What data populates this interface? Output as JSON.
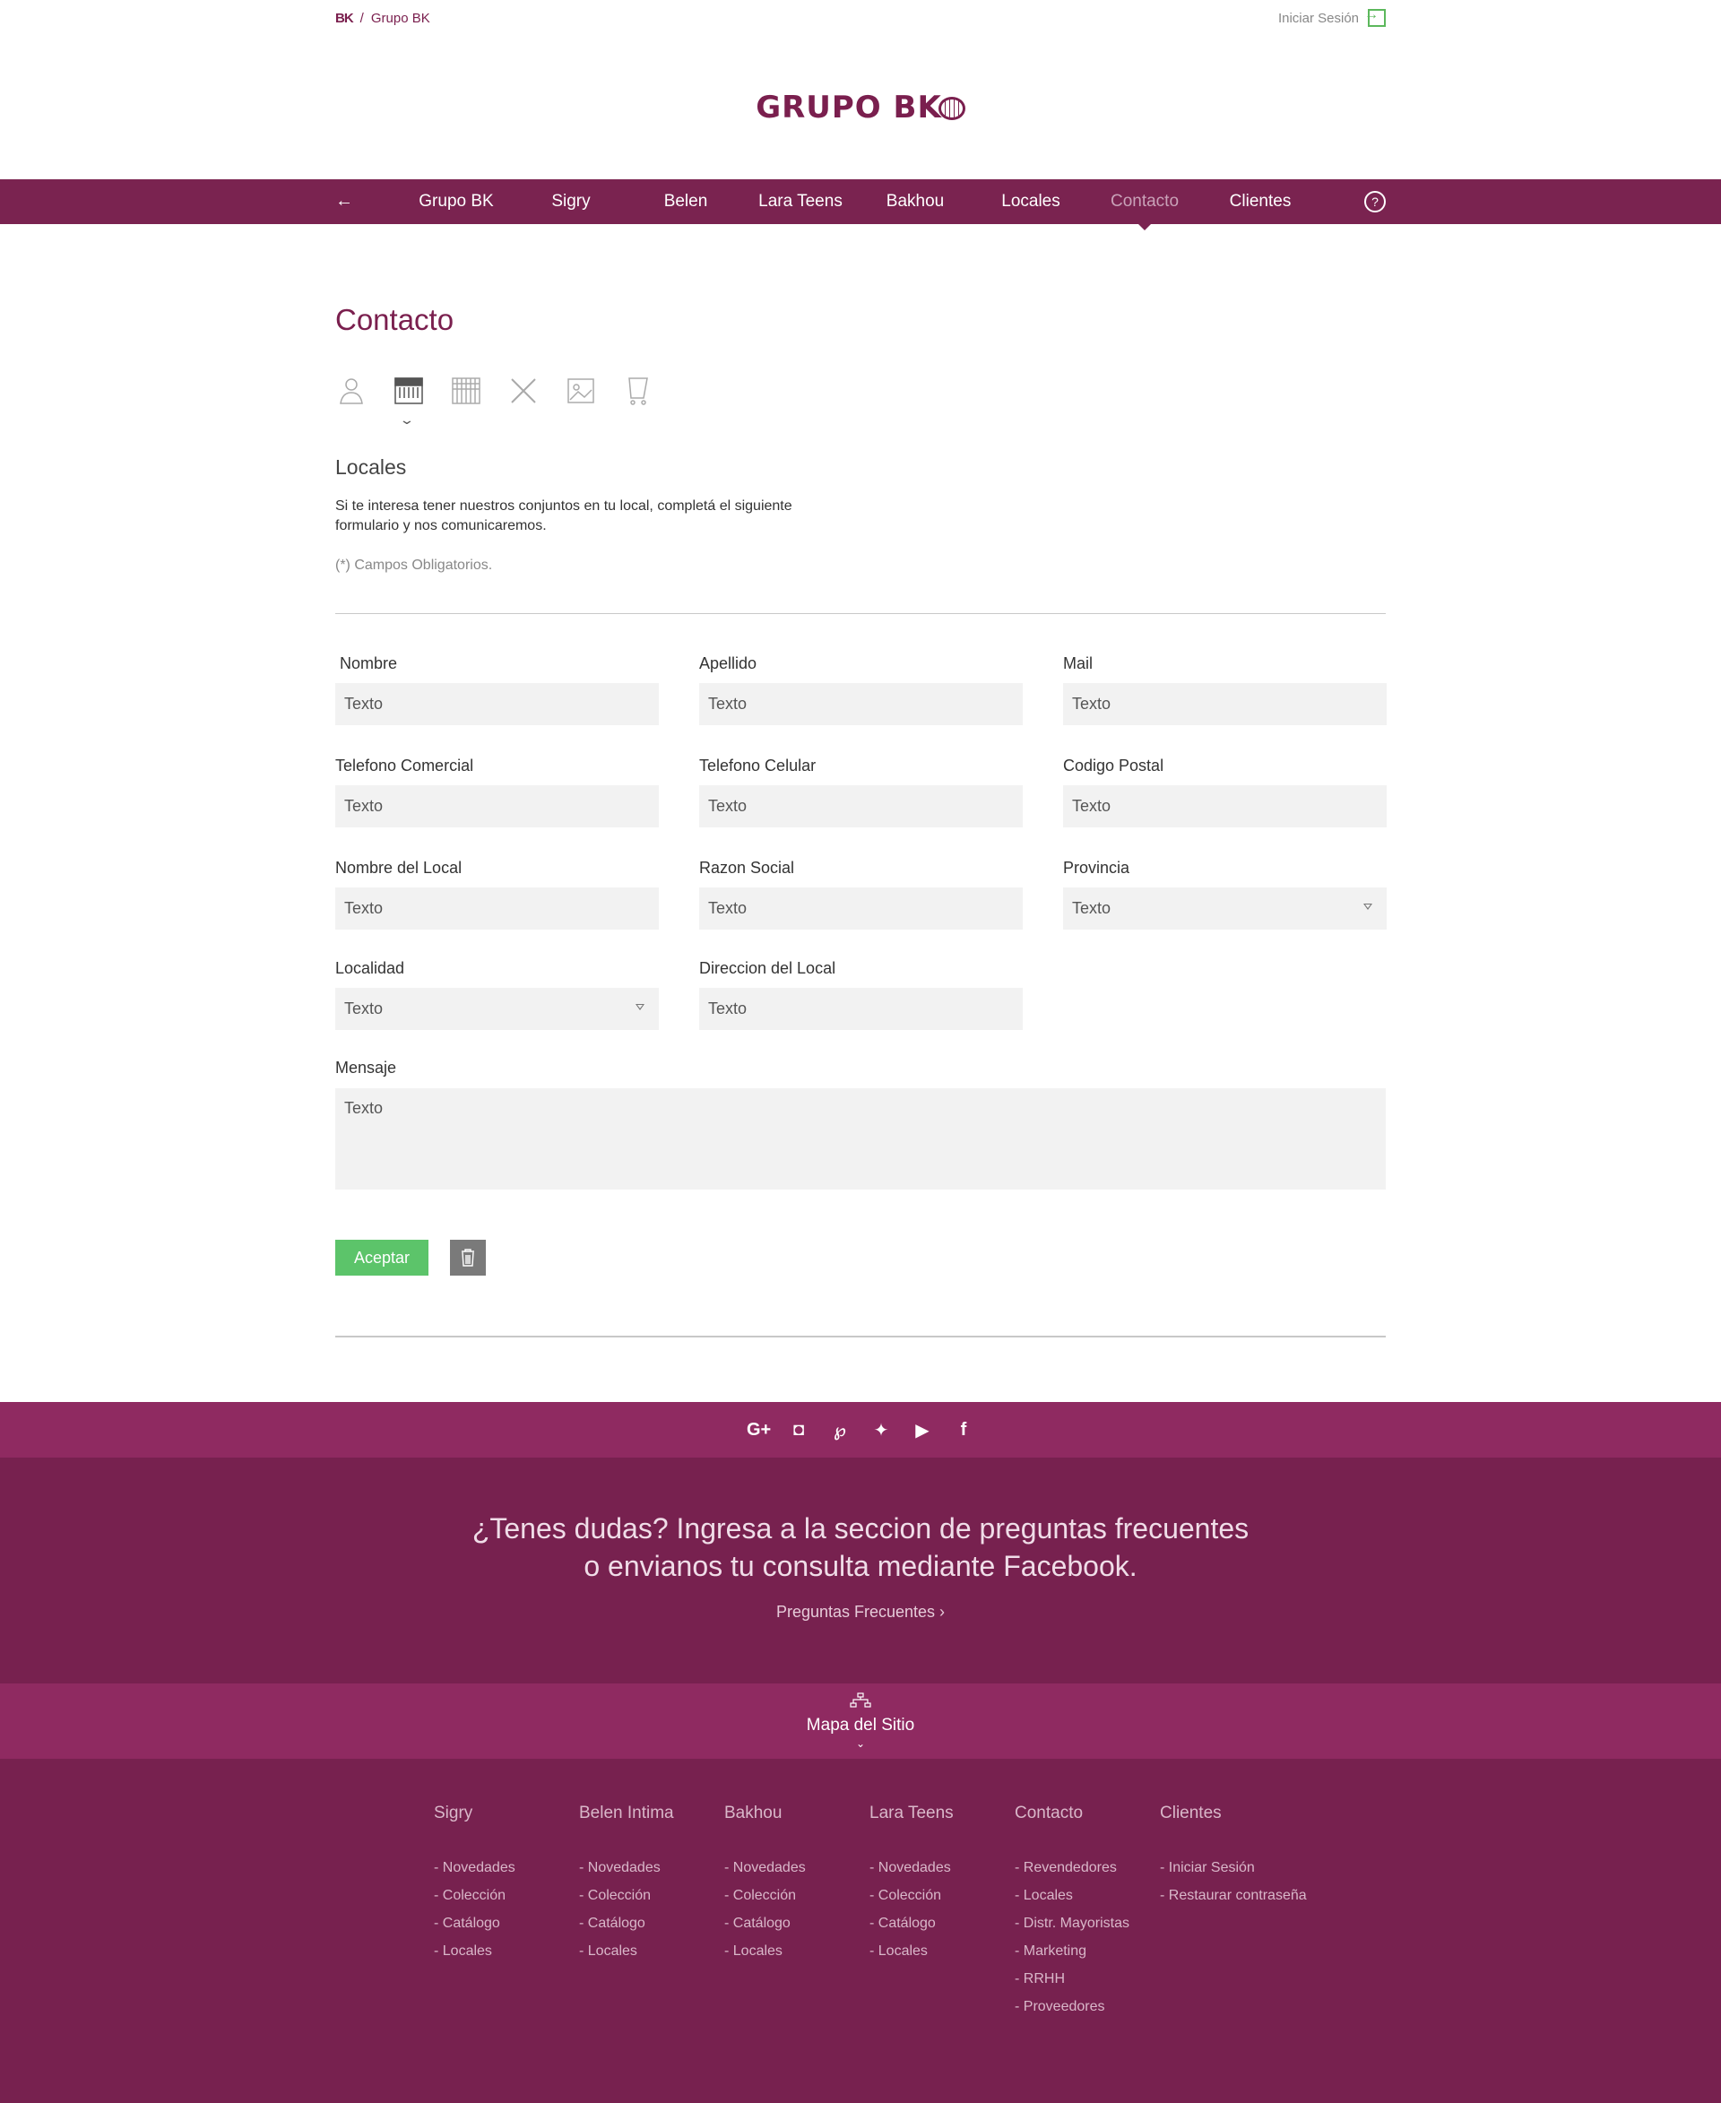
{
  "topbar": {
    "logo_mini": "BK",
    "breadcrumb_sep": "/",
    "breadcrumb_current": "Grupo BK",
    "login_label": "Iniciar Sesión"
  },
  "logo": {
    "text": "GRUPO BK"
  },
  "nav": {
    "items": [
      {
        "label": "Grupo BK"
      },
      {
        "label": "Sigry"
      },
      {
        "label": "Belen"
      },
      {
        "label": "Lara Teens"
      },
      {
        "label": "Bakhou"
      },
      {
        "label": "Locales"
      },
      {
        "label": "Contacto",
        "active": true
      },
      {
        "label": "Clientes"
      }
    ],
    "help_label": "?"
  },
  "contact": {
    "title": "Contacto",
    "categories": [
      {
        "icon": "person-icon"
      },
      {
        "icon": "storefront-icon",
        "active": true
      },
      {
        "icon": "warehouse-icon"
      },
      {
        "icon": "pencil-ruler-icon"
      },
      {
        "icon": "picture-icon"
      },
      {
        "icon": "cart-icon"
      }
    ],
    "section_title": "Locales",
    "section_desc": "Si te interesa tener nuestros conjuntos en tu local, completá el siguiente formulario y nos comunicaremos.",
    "required_note": "(*) Campos Obligatorios."
  },
  "form": {
    "fields": {
      "nombre": {
        "label": "Nombre",
        "value": "Texto"
      },
      "apellido": {
        "label": "Apellido",
        "value": "Texto"
      },
      "mail": {
        "label": "Mail",
        "value": "Texto"
      },
      "telefono_comercial": {
        "label": "Telefono Comercial",
        "value": "Texto"
      },
      "telefono_celular": {
        "label": "Telefono Celular",
        "value": "Texto"
      },
      "codigo_postal": {
        "label": "Codigo Postal",
        "value": "Texto"
      },
      "nombre_local": {
        "label": "Nombre del Local",
        "value": "Texto"
      },
      "razon_social": {
        "label": "Razon Social",
        "value": "Texto"
      },
      "provincia": {
        "label": "Provincia",
        "value": "Texto"
      },
      "localidad": {
        "label": "Localidad",
        "value": "Texto"
      },
      "direccion_local": {
        "label": "Direccion del Local",
        "value": "Texto"
      },
      "mensaje": {
        "label": "Mensaje",
        "value": "Texto"
      }
    },
    "accept_label": "Aceptar"
  },
  "footer": {
    "social": [
      {
        "icon": "google-plus-icon",
        "glyph": "G+"
      },
      {
        "icon": "instagram-icon",
        "glyph": "◘"
      },
      {
        "icon": "pinterest-icon",
        "glyph": "℘"
      },
      {
        "icon": "twitter-icon",
        "glyph": "✦"
      },
      {
        "icon": "youtube-icon",
        "glyph": "▶"
      },
      {
        "icon": "facebook-icon",
        "glyph": "f"
      }
    ],
    "faq_line1": "¿Tenes dudas? Ingresa a la seccion de preguntas frecuentes",
    "faq_line2": "o envianos tu consulta mediante Facebook.",
    "faq_link": "Preguntas Frecuentes  ›",
    "sitemap_label": "Mapa del Sitio",
    "columns": [
      {
        "title": "Sigry",
        "items": [
          "- Novedades",
          "- Colección",
          "- Catálogo",
          "- Locales"
        ]
      },
      {
        "title": "Belen Intima",
        "items": [
          "- Novedades",
          "- Colección",
          "- Catálogo",
          "- Locales"
        ]
      },
      {
        "title": "Bakhou",
        "items": [
          "- Novedades",
          "- Colección",
          "- Catálogo",
          "- Locales"
        ]
      },
      {
        "title": "Lara Teens",
        "items": [
          "- Novedades",
          "- Colección",
          "- Catálogo",
          "- Locales"
        ]
      },
      {
        "title": "Contacto",
        "items": [
          "- Revendedores",
          "- Locales",
          "- Distr. Mayoristas",
          "- Marketing",
          "- RRHH",
          "- Proveedores"
        ]
      },
      {
        "title": "Clientes",
        "items": [
          "- Iniciar Sesión",
          "- Restaurar contraseña"
        ]
      }
    ]
  },
  "colors": {
    "brand": "#7a2350",
    "brand_light": "#8f2a61",
    "accept": "#5cc46a",
    "field_bg": "#f2f2f2"
  }
}
